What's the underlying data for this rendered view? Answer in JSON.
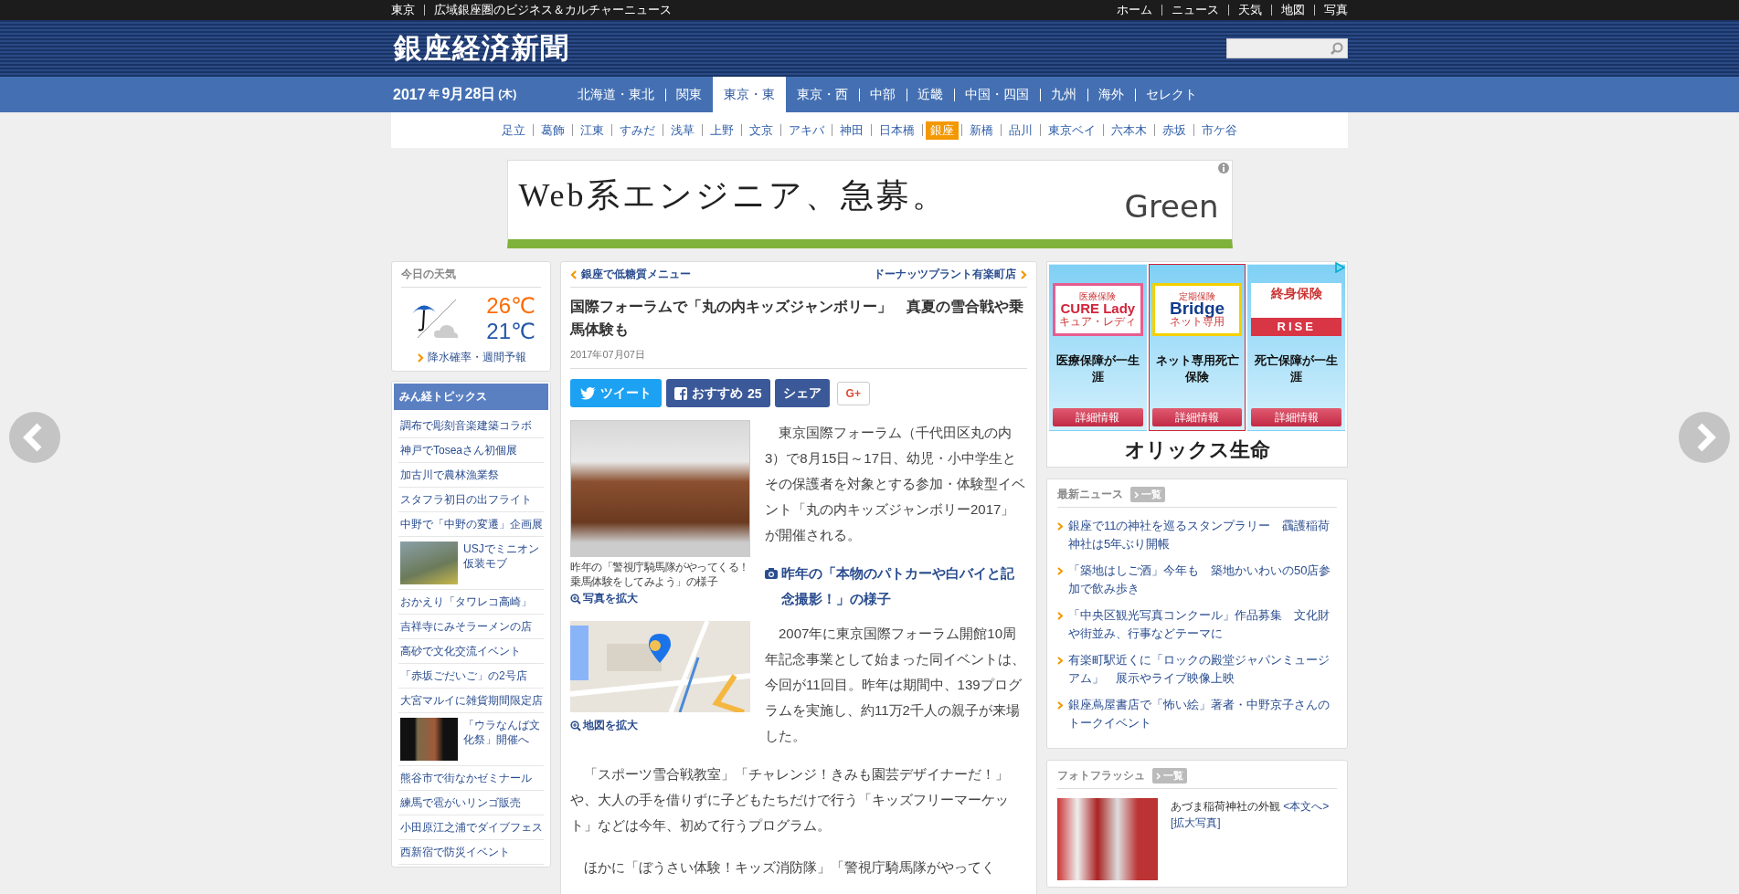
{
  "top_bar": {
    "region": "東京",
    "tagline": "広域銀座圏のビジネス＆カルチャーニュース",
    "links": [
      "ホーム",
      "ニュース",
      "天気",
      "地図",
      "写真"
    ]
  },
  "header": {
    "logo": "銀座経済新聞"
  },
  "date": {
    "year": "2017",
    "year_unit": "年",
    "day": "9月28日",
    "weekday": "(木)"
  },
  "regions": [
    {
      "label": "北海道・東北",
      "selected": false
    },
    {
      "label": "関東",
      "selected": false
    },
    {
      "label": "東京・東",
      "selected": true
    },
    {
      "label": "東京・西",
      "selected": false
    },
    {
      "label": "中部",
      "selected": false
    },
    {
      "label": "近畿",
      "selected": false
    },
    {
      "label": "中国・四国",
      "selected": false
    },
    {
      "label": "九州",
      "selected": false
    },
    {
      "label": "海外",
      "selected": false
    },
    {
      "label": "セレクト",
      "selected": false
    }
  ],
  "areas": [
    {
      "label": "足立",
      "selected": false
    },
    {
      "label": "葛飾",
      "selected": false
    },
    {
      "label": "江東",
      "selected": false
    },
    {
      "label": "すみだ",
      "selected": false
    },
    {
      "label": "浅草",
      "selected": false
    },
    {
      "label": "上野",
      "selected": false
    },
    {
      "label": "文京",
      "selected": false
    },
    {
      "label": "アキバ",
      "selected": false
    },
    {
      "label": "神田",
      "selected": false
    },
    {
      "label": "日本橋",
      "selected": false
    },
    {
      "label": "銀座",
      "selected": true
    },
    {
      "label": "新橋",
      "selected": false
    },
    {
      "label": "品川",
      "selected": false
    },
    {
      "label": "東京ベイ",
      "selected": false
    },
    {
      "label": "六本木",
      "selected": false
    },
    {
      "label": "赤坂",
      "selected": false
    },
    {
      "label": "市ケ谷",
      "selected": false
    }
  ],
  "ad_banner": {
    "headline": "Web系エンジニア、急募。",
    "brand": "Green"
  },
  "weather": {
    "title": "今日の天気",
    "high": "26",
    "low": "21",
    "unit": "℃",
    "link": "降水確率・週間予報"
  },
  "topics": {
    "title": "みん経トピックス",
    "items": [
      {
        "kind": "text",
        "text": "調布で彫刻音楽建築コラボ"
      },
      {
        "kind": "text",
        "text": "神戸でToseaさん初個展"
      },
      {
        "kind": "text",
        "text": "加古川で農林漁業祭"
      },
      {
        "kind": "text",
        "text": "スタフラ初日の出フライト"
      },
      {
        "kind": "text",
        "text": "中野で「中野の変遷」企画展"
      },
      {
        "kind": "photo",
        "text": "USJでミニオン仮装モブ"
      },
      {
        "kind": "text",
        "text": "おかえり「タワレコ高崎」"
      },
      {
        "kind": "text",
        "text": "吉祥寺にみそラーメンの店"
      },
      {
        "kind": "text",
        "text": "高砂で文化交流イベント"
      },
      {
        "kind": "text",
        "text": "「赤坂ごだいご」の2号店"
      },
      {
        "kind": "text",
        "text": "大宮マルイに雑貨期間限定店"
      },
      {
        "kind": "photo",
        "text": "「ウラなんば文化祭」開催へ"
      },
      {
        "kind": "text",
        "text": "熊谷市で街なかゼミナール"
      },
      {
        "kind": "text",
        "text": "練馬で雹がいリンゴ販売"
      },
      {
        "kind": "text",
        "text": "小田原江之浦でダイブフェス"
      },
      {
        "kind": "text",
        "text": "西新宿で防災イベント"
      }
    ]
  },
  "article": {
    "prev": "銀座で低糖質メニュー",
    "next": "ドーナッツプラント有楽町店",
    "title": "国際フォーラムで「丸の内キッズジャンボリー」　真夏の雪合戦や乗馬体験も",
    "date": "2017年07月07日",
    "share": [
      {
        "kind": "tweet",
        "label": "ツイート"
      },
      {
        "kind": "like",
        "label": "おすすめ",
        "count": "25"
      },
      {
        "kind": "share",
        "label": "シェア"
      },
      {
        "kind": "gplus",
        "label": "G+"
      }
    ],
    "photo": {
      "caption": "昨年の「警視庁騎馬隊がやってくる！乗馬体験をしてみよう」の様子",
      "link": "写真を拡大"
    },
    "map": {
      "link": "地図を拡大"
    },
    "photo_link": "昨年の「本物のパトカーや白バイと記念撮影！」の様子",
    "paragraphs": [
      "東京国際フォーラム（千代田区丸の内3）で8月15日～17日、幼児・小中学生とその保護者を対象とする参加・体験型イベント「丸の内キッズジャンボリー2017」が開催される。",
      "2007年に東京国際フォーラム開館10周年記念事業として始まった同イベントは、今回が11回目。昨年は期間中、139プログラムを実施し、約11万2千人の親子が来場した。",
      "「スポーツ雪合戦教室」「チャレンジ！きみも園芸デザイナーだ！」や、大人の手を借りずに子どもたちだけで行う「キッズフリーマーケット」などは今年、初めて行うプログラム。",
      "ほかに「ぼうさい体験！キッズ消防隊」「警視庁騎馬隊がやってく"
    ]
  },
  "insurance_ad": {
    "products": [
      {
        "logo_top": "医療保険",
        "logo": "CURE Lady",
        "logo_bottom": "キュア・レディ",
        "tagline": "医療保障が一生涯",
        "button": "詳細情報",
        "selected": false
      },
      {
        "logo_top": "定期保険",
        "logo": "Bridge",
        "logo_bottom": "ネット専用",
        "tagline": "ネット専用死亡保険",
        "button": "詳細情報",
        "selected": true
      },
      {
        "logo_top": "終身保険",
        "logo": "RISE",
        "tagline": "死亡保障が一生涯",
        "button": "詳細情報",
        "selected": false
      }
    ],
    "brand": "オリックス生命"
  },
  "news": {
    "title": "最新ニュース",
    "more": "一覧",
    "items": [
      "銀座で11の神社を巡るスタンプラリー　靍護稲荷神社は5年ぶり開帳",
      "「築地はしご酒」今年も　築地かいわいの50店参加で飲み歩き",
      "「中央区観光写真コンクール」作品募集　文化財や街並み、行事などテーマに",
      "有楽町駅近くに「ロックの殿堂ジャパンミュージアム」　展示やライブ映像上映",
      "銀座蔦屋書店で「怖い絵」著者・中野京子さんのトークイベント"
    ]
  },
  "photo_flash": {
    "title": "フォトフラッシュ",
    "more": "一覧",
    "caption": "あづま稲荷神社の外観",
    "link": "<本文へ>",
    "enlarge": "[拡大写真]"
  }
}
